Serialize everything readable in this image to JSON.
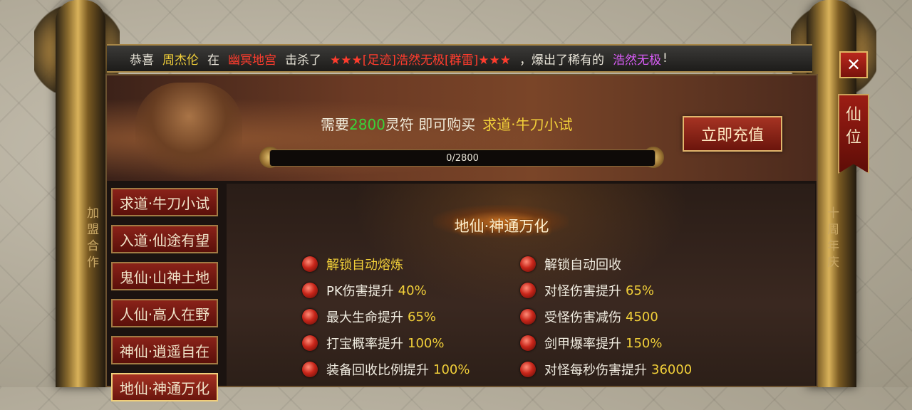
{
  "announcement": {
    "prefix": "恭喜",
    "player": "周杰伦",
    "at": "在",
    "location": "幽冥地宫",
    "killed": "击杀了",
    "boss": "★★★[足迹]浩然无极[群雷]★★★",
    "drop_text": "，爆出了稀有的",
    "item": "浩然无极",
    "exclaim": "!"
  },
  "close_label": "✕",
  "side_tab": {
    "char1": "仙",
    "char2": "位"
  },
  "pillars": {
    "left_text": "加盟合作",
    "right_text": "十周年庆"
  },
  "banner": {
    "need_prefix": "需要",
    "need_amount": "2800",
    "need_suffix": "灵符 即可购买",
    "target_item": "求道·牛刀小试",
    "recharge_label": "立即充值",
    "progress_text": "0/2800",
    "progress_fraction": 0
  },
  "tiers": [
    {
      "label": "求道·牛刀小试"
    },
    {
      "label": "入道·仙途有望"
    },
    {
      "label": "鬼仙·山神土地"
    },
    {
      "label": "人仙·高人在野"
    },
    {
      "label": "神仙·逍遥自在"
    },
    {
      "label": "地仙·神通万化"
    }
  ],
  "content": {
    "title": "地仙·神通万化",
    "attributes_left": [
      {
        "name": "解锁自动熔炼",
        "value": "",
        "highlight": true
      },
      {
        "name": "PK伤害提升",
        "value": "40%",
        "highlight": false
      },
      {
        "name": "最大生命提升",
        "value": "65%",
        "highlight": false
      },
      {
        "name": "打宝概率提升",
        "value": "100%",
        "highlight": false
      },
      {
        "name": "装备回收比例提升",
        "value": "100%",
        "highlight": false
      }
    ],
    "attributes_right": [
      {
        "name": "解锁自动回收",
        "value": "",
        "highlight": false
      },
      {
        "name": "对怪伤害提升",
        "value": "65%",
        "highlight": false
      },
      {
        "name": "受怪伤害减伤",
        "value": "4500",
        "highlight": false
      },
      {
        "name": "剑甲爆率提升",
        "value": "150%",
        "highlight": false
      },
      {
        "name": "对怪每秒伤害提升",
        "value": "36000",
        "highlight": false
      }
    ]
  },
  "colors": {
    "player": "#f1cf39",
    "location": "#ff3c2d",
    "boss": "#ff3c2d",
    "item": "#d85cf6",
    "currency": "#39d439"
  }
}
